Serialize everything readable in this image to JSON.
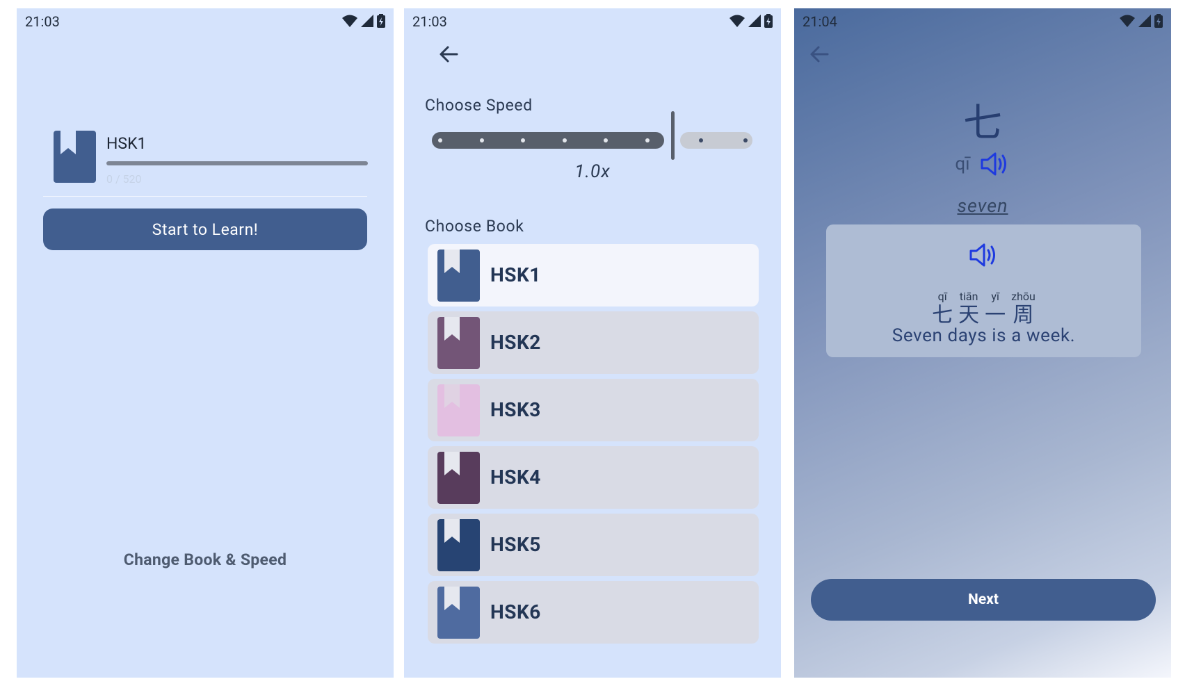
{
  "screens": [
    {
      "status": {
        "time": "21:03"
      },
      "book": {
        "title": "HSK1",
        "progress_text": "0 / 520",
        "progress": 0
      },
      "start_label": "Start to Learn!",
      "change_label": "Change Book & Speed"
    },
    {
      "status": {
        "time": "21:03"
      },
      "speed": {
        "heading": "Choose Speed",
        "value_text": "1.0x",
        "steps": 9,
        "selected_step": 6
      },
      "books_heading": "Choose Book",
      "books": [
        {
          "label": "HSK1",
          "color": "#415e8f",
          "selected": true
        },
        {
          "label": "HSK2",
          "color": "#735577",
          "selected": false
        },
        {
          "label": "HSK3",
          "color": "#e3bfe1",
          "selected": false
        },
        {
          "label": "HSK4",
          "color": "#583c5c",
          "selected": false
        },
        {
          "label": "HSK5",
          "color": "#274473",
          "selected": false
        },
        {
          "label": "HSK6",
          "color": "#4f6ba0",
          "selected": false
        }
      ]
    },
    {
      "status": {
        "time": "21:04"
      },
      "word": {
        "hanzi": "七",
        "pinyin": "qī",
        "meaning": "seven"
      },
      "example": {
        "chars": [
          {
            "pinyin": "qī",
            "hanzi": "七"
          },
          {
            "pinyin": "tiān",
            "hanzi": "天"
          },
          {
            "pinyin": "yī",
            "hanzi": "一"
          },
          {
            "pinyin": "zhōu",
            "hanzi": "周"
          }
        ],
        "translation": "Seven days is a week."
      },
      "next_label": "Next"
    }
  ],
  "colors": {
    "primary": "#415e8f",
    "background": "#d5e3fc",
    "speaker": "#1e3adf"
  }
}
